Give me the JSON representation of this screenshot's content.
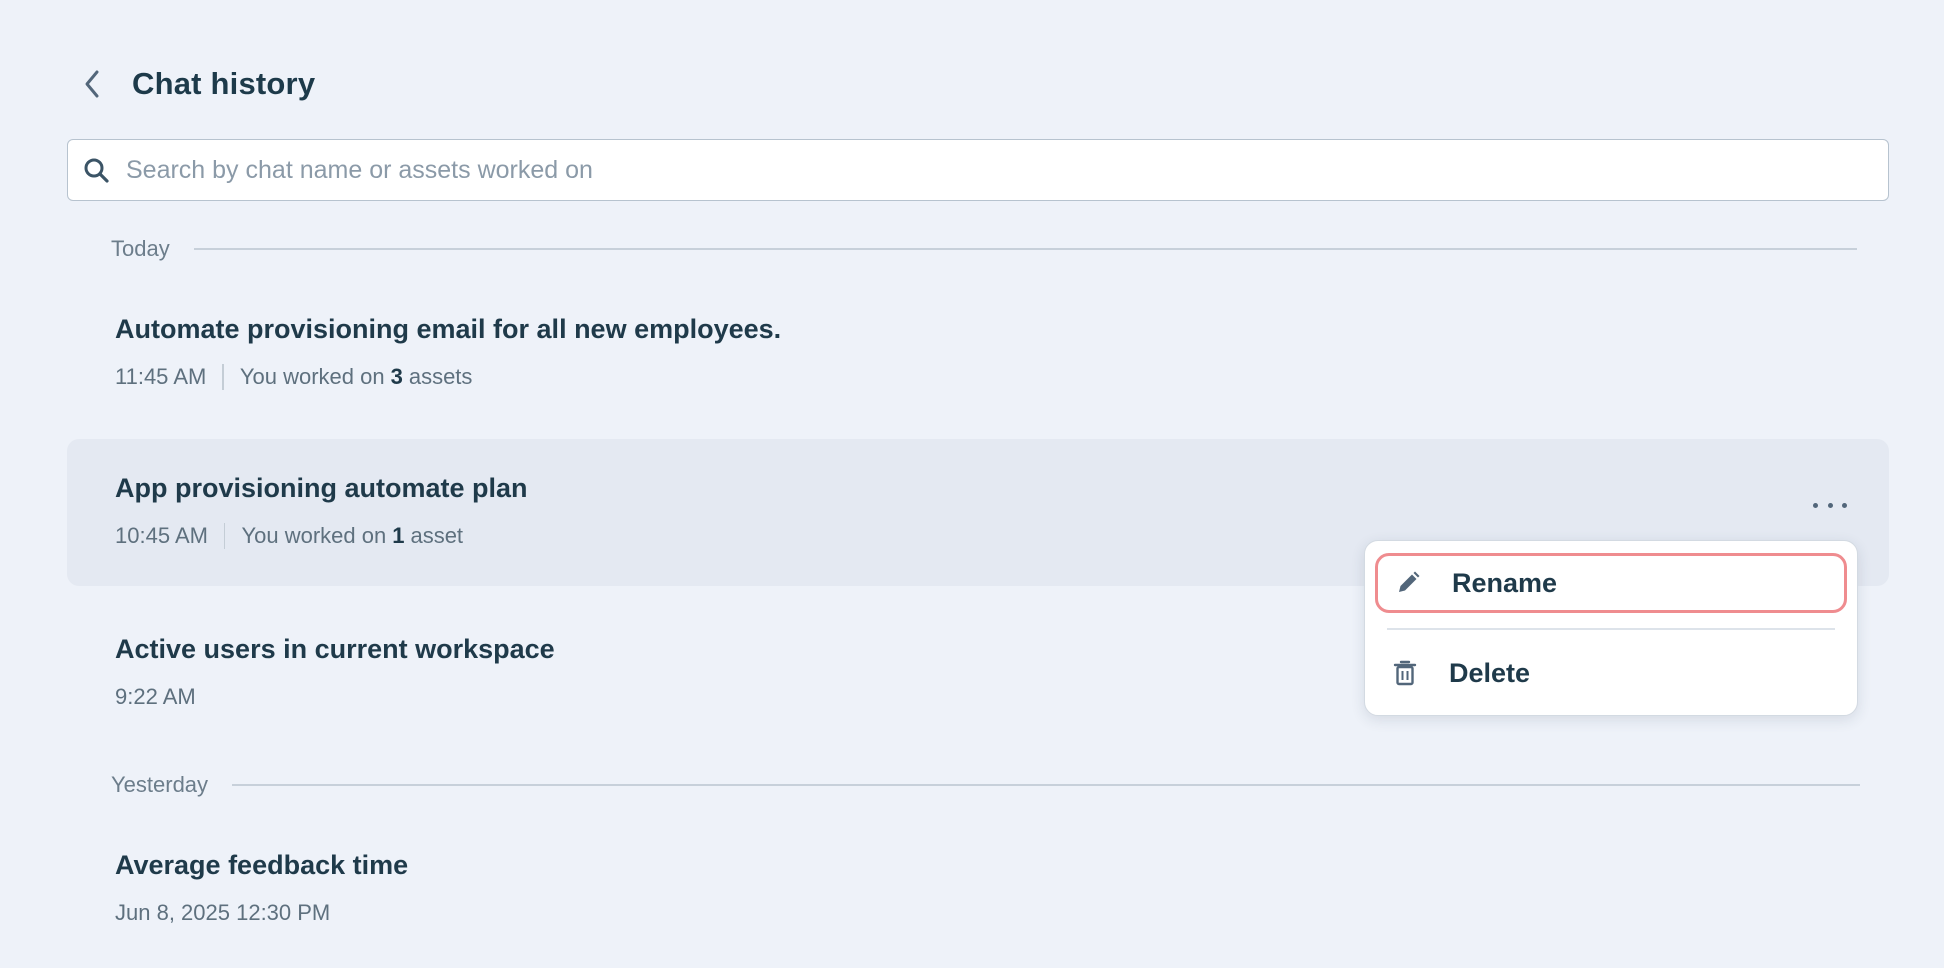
{
  "header": {
    "title": "Chat history"
  },
  "search": {
    "placeholder": "Search by chat name or assets worked on",
    "value": ""
  },
  "sections": [
    {
      "label": "Today",
      "items": [
        {
          "title": "Automate provisioning email for all new employees.",
          "time": "11:45 AM",
          "meta_prefix": "You worked on",
          "count": "3",
          "meta_suffix": "assets"
        },
        {
          "title": "App provisioning automate plan",
          "time": "10:45 AM",
          "meta_prefix": "You worked on",
          "count": "1",
          "meta_suffix": "asset"
        },
        {
          "title": "Active users in current workspace",
          "time": "9:22 AM"
        }
      ]
    },
    {
      "label": "Yesterday",
      "items": [
        {
          "title": "Average feedback time",
          "time": "Jun 8, 2025 12:30 PM"
        }
      ]
    }
  ],
  "context_menu": {
    "rename_label": "Rename",
    "delete_label": "Delete"
  },
  "icons": {
    "back": "chevron-left-icon",
    "search": "search-icon",
    "more": "more-horizontal-icon",
    "rename": "pencil-icon",
    "delete": "trash-icon"
  },
  "colors": {
    "background": "#eef2f9",
    "active_row": "#e4e9f2",
    "text_primary": "#1f3a4a",
    "text_muted": "#5e707e",
    "highlight_border": "#ef8c8f"
  }
}
